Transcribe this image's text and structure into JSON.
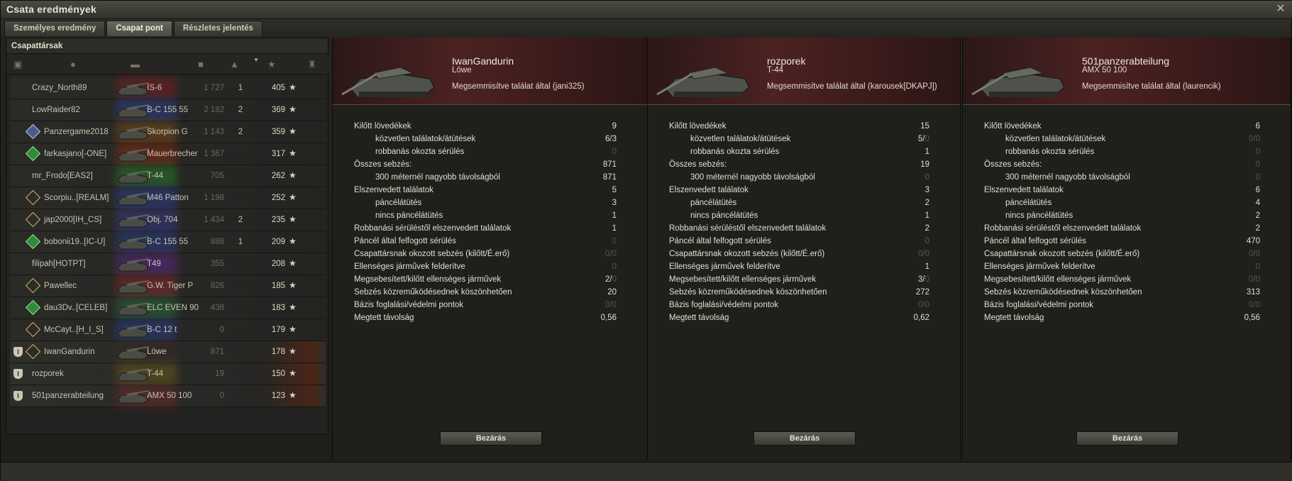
{
  "window": {
    "title": "Csata eredmények"
  },
  "tabs": [
    {
      "label": "Személyes eredmény"
    },
    {
      "label": "Csapat pont"
    },
    {
      "label": "Részletes jelentés"
    }
  ],
  "team": {
    "title": "Csapattársak",
    "rows": [
      {
        "name": "Crazy_North89",
        "tank": "IS-6",
        "damage": "1 727",
        "kills": "1",
        "xp": "405"
      },
      {
        "name": "LowRaider82",
        "tank": "B-C 155 55",
        "damage": "2 182",
        "kills": "2",
        "xp": "369"
      },
      {
        "name": "Panzergame2018",
        "tank": "Skorpion G",
        "damage": "1 143",
        "kills": "2",
        "xp": "359"
      },
      {
        "name": "farkasjano[-ONE]",
        "tank": "Mauerbrecher",
        "damage": "1 367",
        "kills": "",
        "xp": "317"
      },
      {
        "name": "mr_Frodo[EAS2]",
        "tank": "T-44",
        "damage": "705",
        "kills": "",
        "xp": "262"
      },
      {
        "name": "Scorpiu..[REALM]",
        "tank": "M46 Patton",
        "damage": "1 198",
        "kills": "",
        "xp": "252"
      },
      {
        "name": "jap2000[IH_CS]",
        "tank": "Obj. 704",
        "damage": "1 434",
        "kills": "2",
        "xp": "235"
      },
      {
        "name": "bobonii19..[IC-U]",
        "tank": "B-C 155 55",
        "damage": "886",
        "kills": "1",
        "xp": "209"
      },
      {
        "name": "filipah[HOTPT]",
        "tank": "T49",
        "damage": "355",
        "kills": "",
        "xp": "208"
      },
      {
        "name": "Pawellec",
        "tank": "G.W. Tiger P",
        "damage": "826",
        "kills": "",
        "xp": "185"
      },
      {
        "name": "dau3Dv..[CELEB]",
        "tank": "ELC EVEN 90",
        "damage": "438",
        "kills": "",
        "xp": "183"
      },
      {
        "name": "McCayt..[H_I_S]",
        "tank": "B-C 12 t",
        "damage": "0",
        "kills": "",
        "xp": "179"
      },
      {
        "name": "IwanGandurin",
        "tank": "Löwe",
        "damage": "871",
        "kills": "",
        "xp": "178"
      },
      {
        "name": "rozporek",
        "tank": "T-44",
        "damage": "19",
        "kills": "",
        "xp": "150"
      },
      {
        "name": "501panzerabteilung",
        "tank": "AMX 50 100",
        "damage": "0",
        "kills": "",
        "xp": "123"
      }
    ]
  },
  "stat_labels": [
    "Kilőtt lövedékek",
    "közvetlen találatok/átütések",
    "robbanás okozta sérülés",
    "Összes sebzés:",
    "300 méternél nagyobb távolságból",
    "Elszenvedett találatok",
    "páncélátütés",
    "nincs páncélátütés",
    "Robbanási sérüléstől elszenvedett találatok",
    "Páncél által felfogott sérülés",
    "Csapattársnak okozott sebzés (kilőtt/É.erő)",
    "Ellenséges járművek felderítve",
    "Megsebesített/kilőtt ellenséges járművek",
    "Sebzés közreműködésednek köszönhetően",
    "Bázis foglalási/védelmi pontok",
    "Megtett távolság"
  ],
  "panels": [
    {
      "player": "IwanGandurin",
      "tank": "Löwe",
      "death": "Megsemmisítve találat által (jani325)",
      "values": [
        "9",
        [
          "6/3",
          ""
        ],
        "0",
        "871",
        "871",
        "5",
        "3",
        "1",
        "1",
        "0",
        "0/0",
        "0",
        [
          "2/",
          "0"
        ],
        "20",
        "0/0",
        "0,56"
      ],
      "close": "Bezárás"
    },
    {
      "player": "rozporek",
      "tank": "T-44",
      "death": "Megsemmisítve találat által (karousek[DKAPJ])",
      "values": [
        "15",
        [
          "5/",
          "0"
        ],
        "1",
        "19",
        "0",
        "3",
        "2",
        "1",
        "2",
        "0",
        "0/0",
        "1",
        [
          "3/",
          "0"
        ],
        "272",
        "0/0",
        "0,62"
      ],
      "close": "Bezárás"
    },
    {
      "player": "501panzerabteilung",
      "tank": "AMX 50 100",
      "death": "Megsemmisítve találat által (laurencik)",
      "values": [
        "6",
        [
          "",
          "0/0"
        ],
        "0",
        "0",
        "0",
        "6",
        "4",
        "2",
        "2",
        "470",
        "0/0",
        "0",
        "0/0",
        "313",
        "0/0",
        "0,56"
      ],
      "close": "Bezárás"
    }
  ]
}
